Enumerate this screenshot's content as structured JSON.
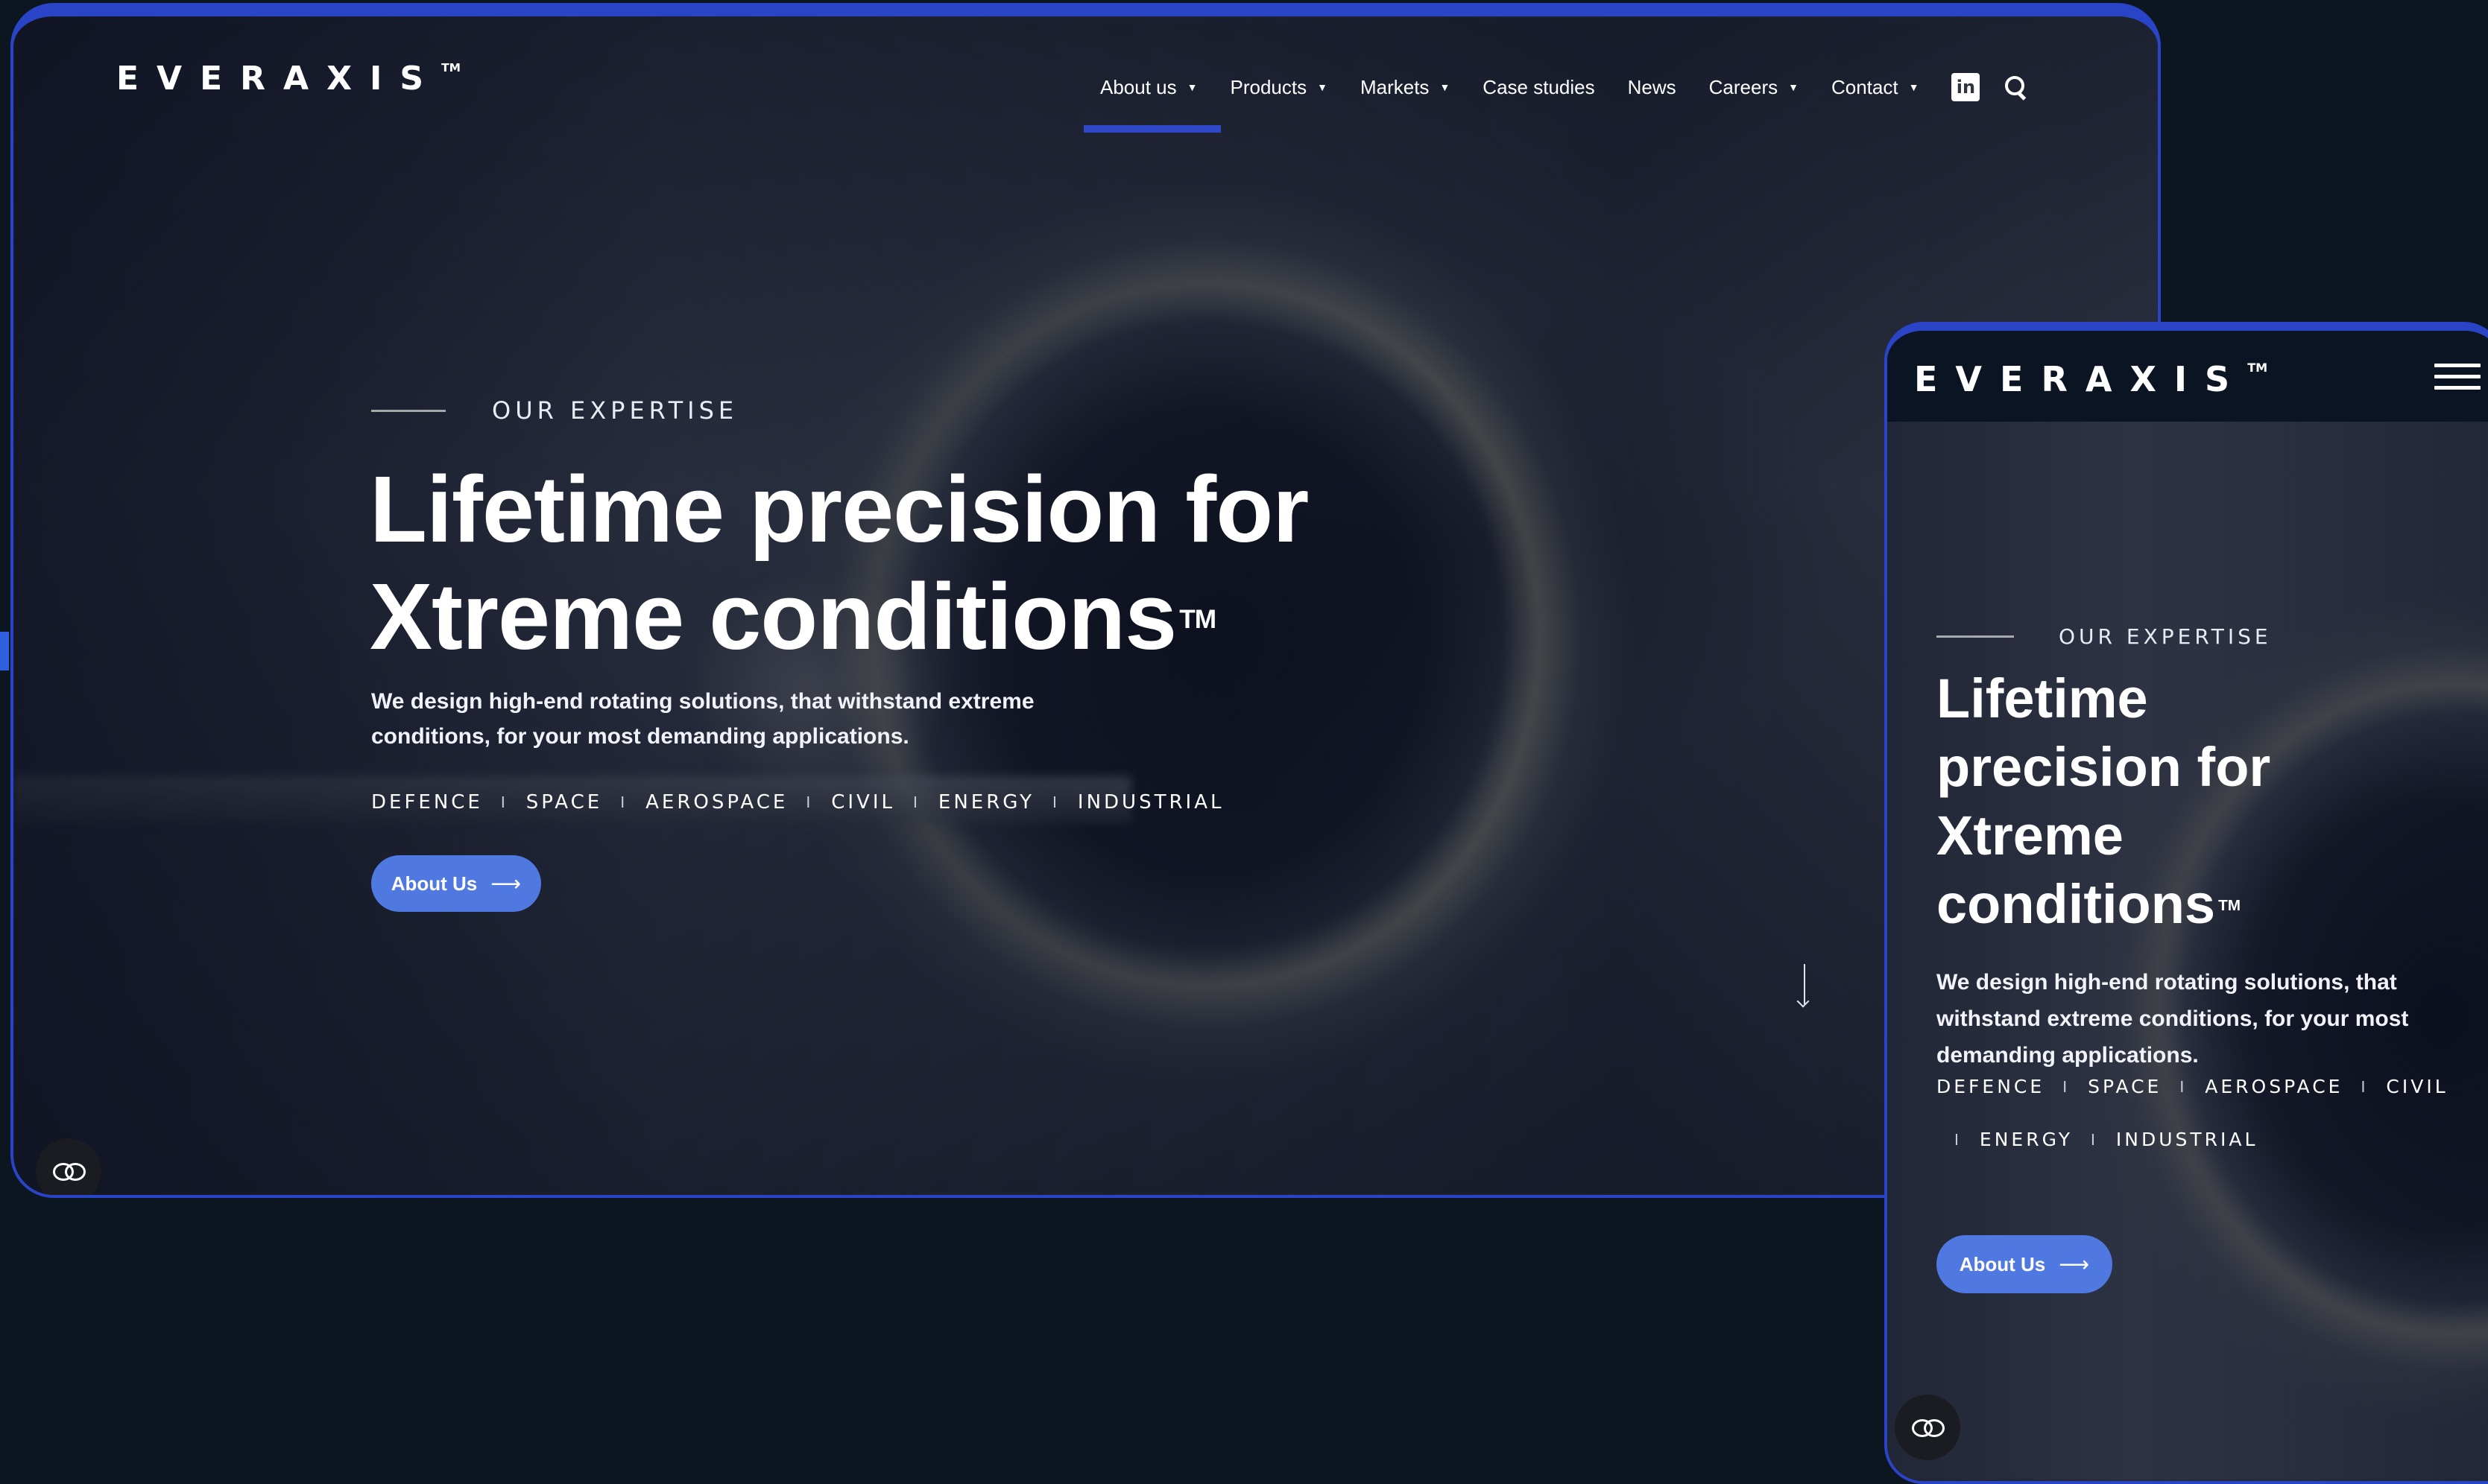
{
  "brand": {
    "name": "EVERAXIS",
    "trademark": "TM"
  },
  "desktop": {
    "nav": [
      {
        "label": "About us",
        "dropdown": true,
        "active": true
      },
      {
        "label": "Products",
        "dropdown": true
      },
      {
        "label": "Markets",
        "dropdown": true
      },
      {
        "label": "Case studies",
        "dropdown": false
      },
      {
        "label": "News",
        "dropdown": false
      },
      {
        "label": "Careers",
        "dropdown": true
      },
      {
        "label": "Contact",
        "dropdown": true
      }
    ],
    "social_icon": "linkedin-icon",
    "linkedin_glyph": "in",
    "search_icon": "search-icon"
  },
  "hero": {
    "eyebrow": "OUR EXPERTISE",
    "headline_line1": "Lifetime precision for",
    "headline_line2": "Xtreme conditions",
    "headline_mobile_1": "Lifetime",
    "headline_mobile_2": "precision for",
    "headline_mobile_3": "Xtreme",
    "headline_mobile_4": "conditions",
    "headline_tm": "TM",
    "description": "We design high-end rotating solutions, that withstand extreme conditions, for your most demanding applications.",
    "markets": [
      "DEFENCE",
      "SPACE",
      "AEROSPACE",
      "CIVIL",
      "ENERGY",
      "INDUSTRIAL"
    ],
    "separator": "I",
    "cta_label": "About Us",
    "cta_arrow": "⟶"
  },
  "colors": {
    "accent": "#2f48c8",
    "button": "#4f78e0",
    "page_bg": "#0b1620",
    "header_mobile": "#0a1422"
  },
  "icons": [
    "chevron-down-icon",
    "linkedin-icon",
    "search-icon",
    "scroll-down-arrow-icon",
    "accessibility-loop-icon",
    "hamburger-menu-icon",
    "arrow-right-icon"
  ]
}
